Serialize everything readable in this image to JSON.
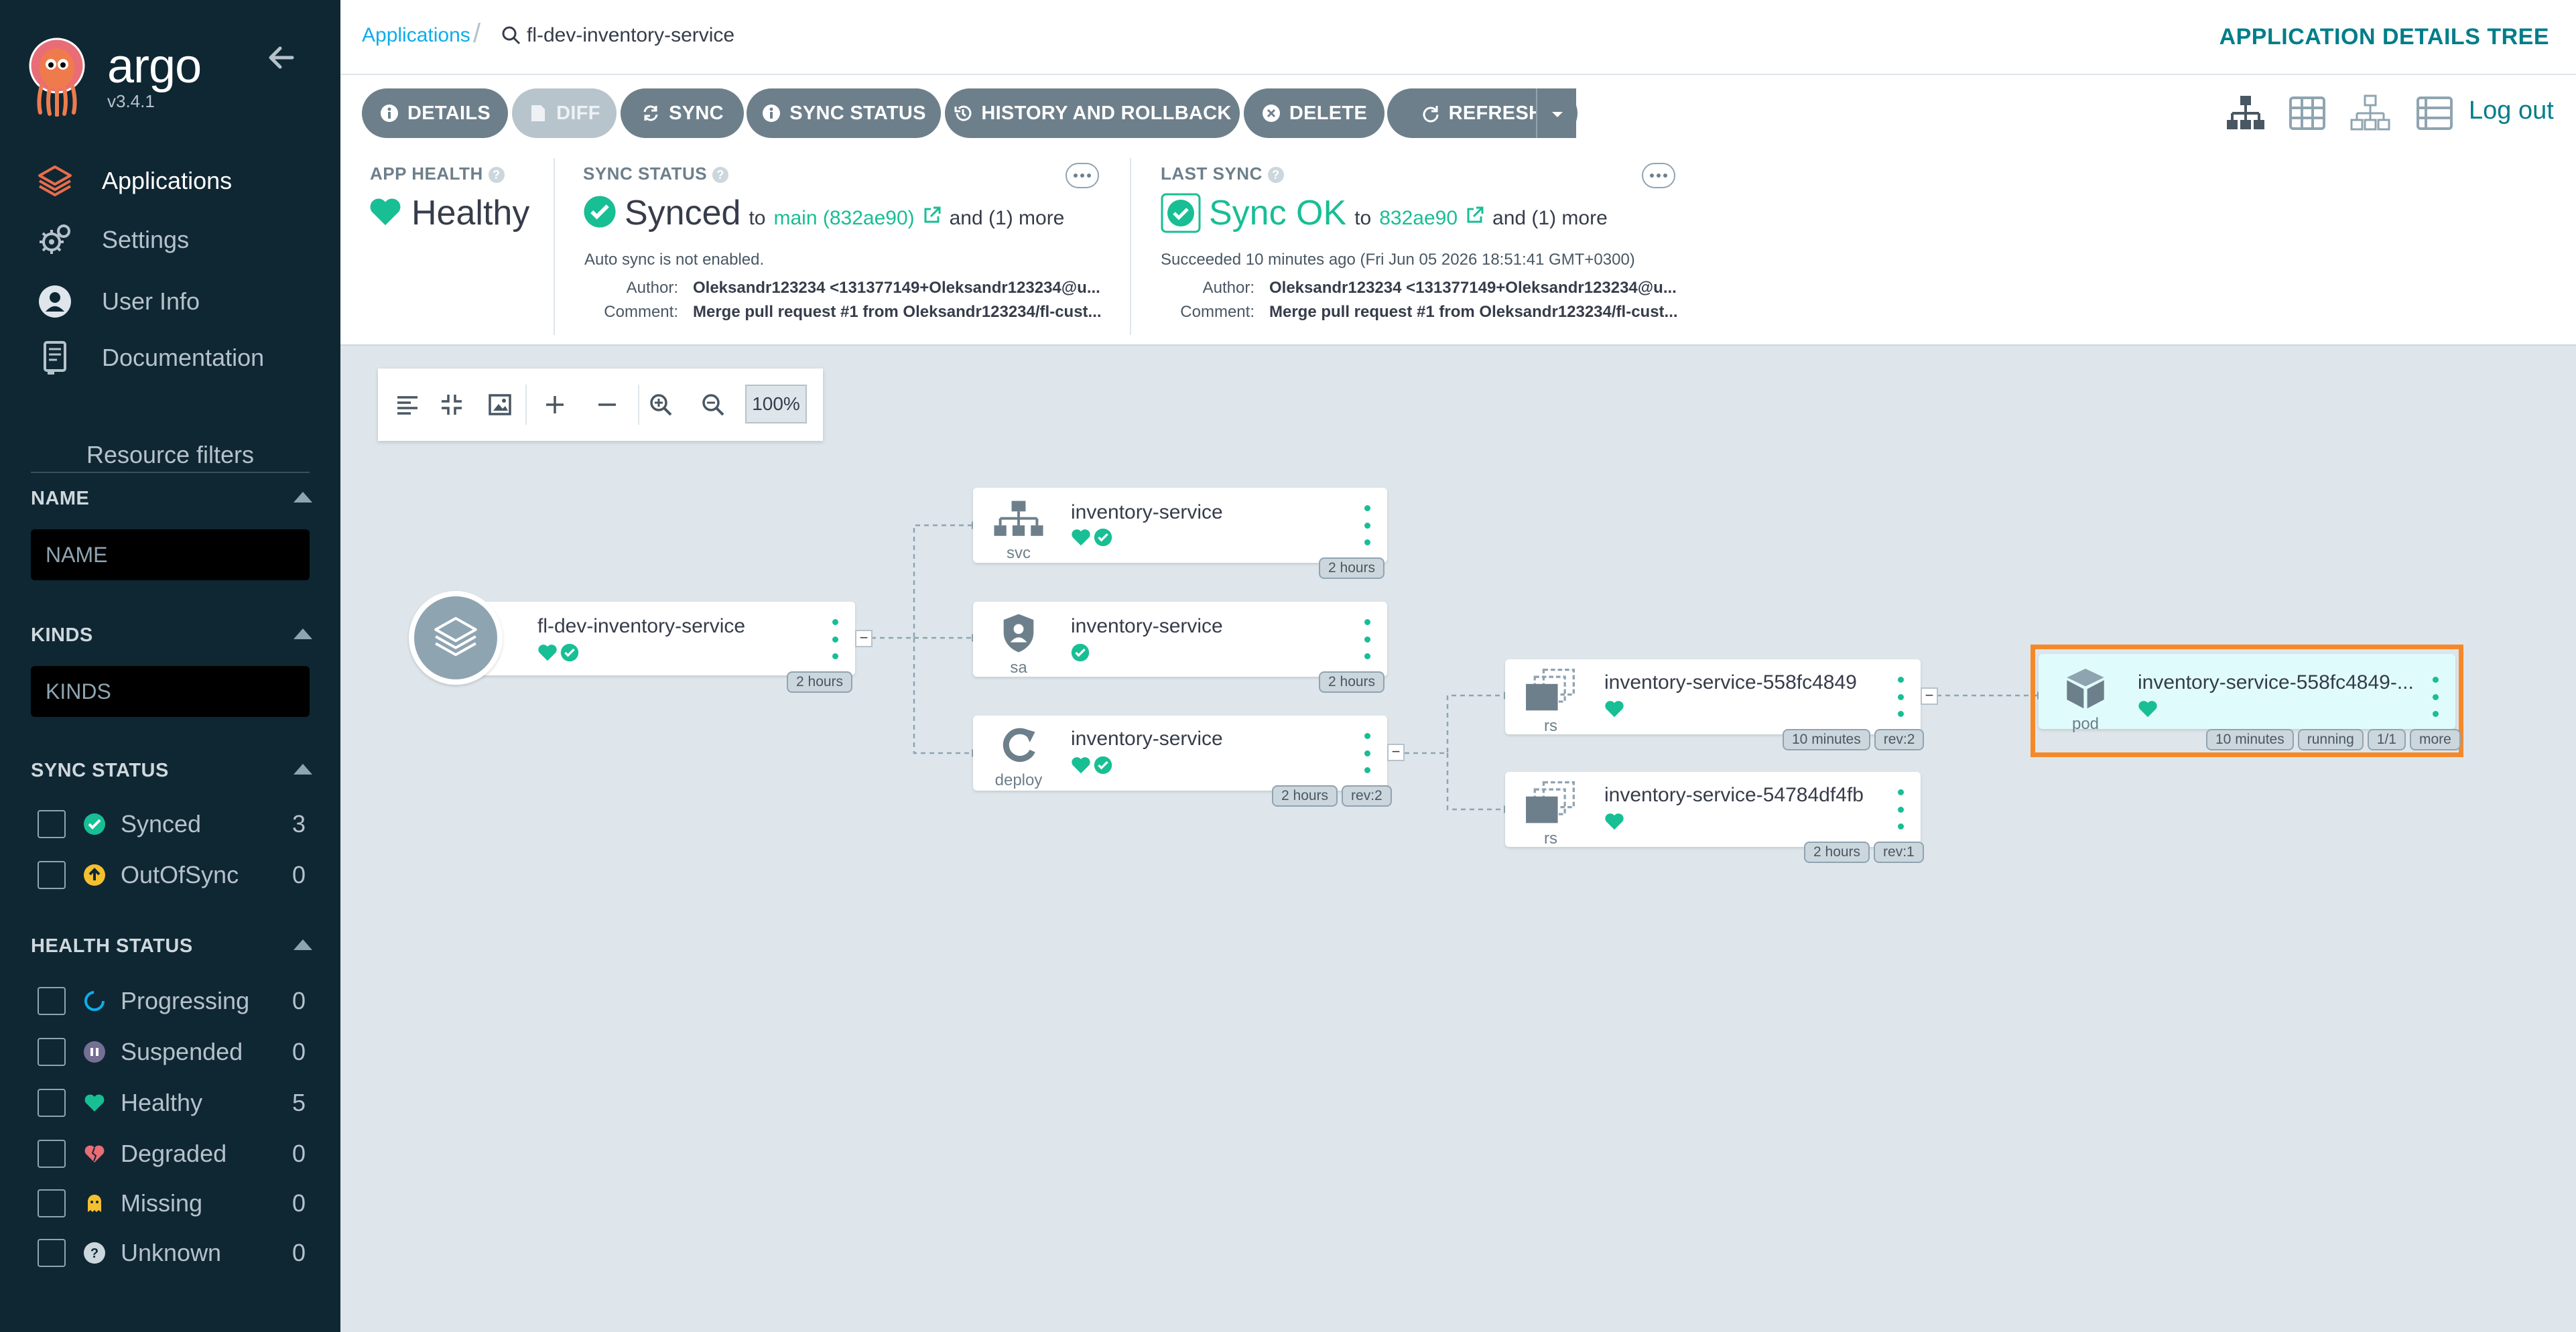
{
  "sidebar": {
    "brand": "argo",
    "version": "v3.4.1",
    "nav": [
      {
        "label": "Applications",
        "icon": "layers-icon"
      },
      {
        "label": "Settings",
        "icon": "gears-icon"
      },
      {
        "label": "User Info",
        "icon": "user-circle-icon"
      },
      {
        "label": "Documentation",
        "icon": "book-icon"
      }
    ],
    "resource_filters_title": "Resource filters",
    "name_filter": {
      "title": "NAME",
      "placeholder": "NAME"
    },
    "kinds_filter": {
      "title": "KINDS",
      "placeholder": "KINDS"
    },
    "sync_status": {
      "title": "SYNC STATUS",
      "items": [
        {
          "label": "Synced",
          "count": "3"
        },
        {
          "label": "OutOfSync",
          "count": "0"
        }
      ]
    },
    "health_status": {
      "title": "HEALTH STATUS",
      "items": [
        {
          "label": "Progressing",
          "count": "0"
        },
        {
          "label": "Suspended",
          "count": "0"
        },
        {
          "label": "Healthy",
          "count": "5"
        },
        {
          "label": "Degraded",
          "count": "0"
        },
        {
          "label": "Missing",
          "count": "0"
        },
        {
          "label": "Unknown",
          "count": "0"
        }
      ]
    }
  },
  "topbar": {
    "breadcrumb_root": "Applications",
    "breadcrumb_current": "fl-dev-inventory-service",
    "page_title": "APPLICATION DETAILS TREE"
  },
  "toolbar": {
    "details": "DETAILS",
    "diff": "DIFF",
    "sync": "SYNC",
    "sync_status": "SYNC STATUS",
    "history": "HISTORY AND ROLLBACK",
    "delete": "DELETE",
    "refresh": "REFRESH",
    "logout": "Log out"
  },
  "status": {
    "app_health": {
      "label": "APP HEALTH",
      "value": "Healthy"
    },
    "sync_status": {
      "label": "SYNC STATUS",
      "value": "Synced",
      "to": "to",
      "revision": "main (832ae90)",
      "more": "and (1) more",
      "auto_sync": "Auto sync is not enabled.",
      "author_label": "Author:",
      "author": "Oleksandr123234 <131377149+Oleksandr123234@u...",
      "comment_label": "Comment:",
      "comment": "Merge pull request #1 from Oleksandr123234/fl-cust..."
    },
    "last_sync": {
      "label": "LAST SYNC",
      "value": "Sync OK",
      "to": "to",
      "revision": "832ae90",
      "more": "and (1) more",
      "succeeded": "Succeeded 10 minutes ago (Fri Jun 05 2026 18:51:41 GMT+0300)",
      "author_label": "Author:",
      "author": "Oleksandr123234 <131377149+Oleksandr123234@u...",
      "comment_label": "Comment:",
      "comment": "Merge pull request #1 from Oleksandr123234/fl-cust..."
    }
  },
  "graph": {
    "zoom": "100%",
    "root": {
      "name": "fl-dev-inventory-service",
      "tags": [
        "2 hours"
      ]
    },
    "svc": {
      "kind": "svc",
      "name": "inventory-service",
      "tags": [
        "2 hours"
      ]
    },
    "sa": {
      "kind": "sa",
      "name": "inventory-service",
      "tags": [
        "2 hours"
      ]
    },
    "deploy": {
      "kind": "deploy",
      "name": "inventory-service",
      "tags": [
        "2 hours",
        "rev:2"
      ]
    },
    "rs1": {
      "kind": "rs",
      "name": "inventory-service-558fc4849",
      "tags": [
        "10 minutes",
        "rev:2"
      ]
    },
    "rs2": {
      "kind": "rs",
      "name": "inventory-service-54784df4fb",
      "tags": [
        "2 hours",
        "rev:1"
      ]
    },
    "pod": {
      "kind": "pod",
      "name": "inventory-service-558fc4849-...",
      "tags": [
        "10 minutes",
        "running",
        "1/1",
        "more"
      ]
    }
  },
  "colors": {
    "sidebar_bg": "#0f2733",
    "teal": "#18be94",
    "accent": "#007d89",
    "selection": "#f5892a"
  }
}
